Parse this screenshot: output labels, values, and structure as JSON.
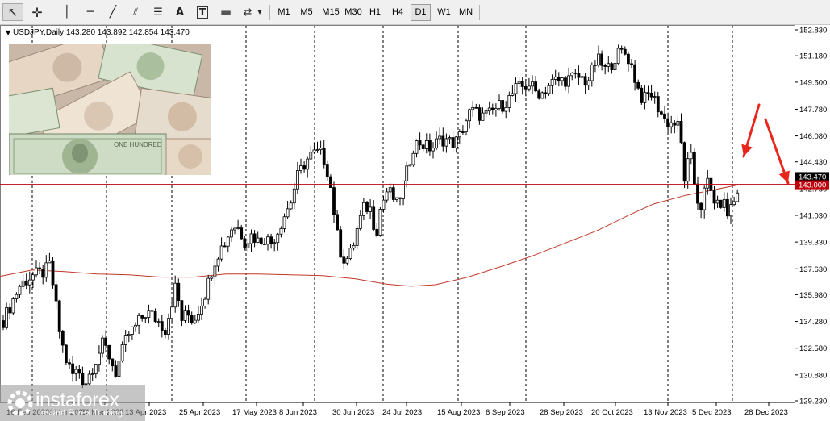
{
  "toolbar": {
    "tools": [
      {
        "name": "cursor-tool-button",
        "icon": "cursor-arrow-icon",
        "glyph": "↖",
        "selected": true
      },
      {
        "name": "crosshair-tool-button",
        "icon": "crosshair-icon",
        "glyph": "✛",
        "selected": false
      },
      {
        "name": "vertical-line-button",
        "icon": "vertical-line-icon",
        "glyph": "│",
        "selected": false
      },
      {
        "name": "horizontal-line-button",
        "icon": "horizontal-line-icon",
        "glyph": "─",
        "selected": false
      },
      {
        "name": "trendline-button",
        "icon": "trendline-icon",
        "glyph": "╱",
        "selected": false
      },
      {
        "name": "equidistant-channel-button",
        "icon": "channel-icon",
        "glyph": "⫽",
        "selected": false
      },
      {
        "name": "fibonacci-button",
        "icon": "fibonacci-icon",
        "glyph": "☰",
        "selected": false
      },
      {
        "name": "text-button",
        "icon": "text-icon",
        "glyph": "A",
        "selected": false
      },
      {
        "name": "text-label-button",
        "icon": "text-label-icon",
        "glyph": "T",
        "selected": false
      },
      {
        "name": "rectangle-shape-button",
        "icon": "rectangle-icon",
        "glyph": "▬",
        "selected": false
      },
      {
        "name": "arrows-shapes-button",
        "icon": "arrows-icon",
        "glyph": "⇄",
        "selected": false
      },
      {
        "name": "shapes-dropdown-button",
        "icon": "chevron-down-icon",
        "glyph": "▾",
        "selected": false
      }
    ],
    "timeframes": [
      "M1",
      "M5",
      "M15",
      "M30",
      "H1",
      "H4",
      "D1",
      "W1",
      "MN"
    ],
    "selected_timeframe": "D1"
  },
  "chart_title": "USDJPY,Daily  143.280 143.892 142.854 143.470",
  "chart_data": {
    "type": "candlestick",
    "symbol": "USDJPY",
    "timeframe": "Daily",
    "ohlc": {
      "open": 143.28,
      "high": 143.892,
      "low": 142.854,
      "close": 143.47
    },
    "y_ticks": [
      152.83,
      151.18,
      149.5,
      147.78,
      146.08,
      144.43,
      142.73,
      141.03,
      139.33,
      137.63,
      135.98,
      134.28,
      132.58,
      130.88,
      129.23
    ],
    "ylim": [
      129.23,
      152.83
    ],
    "x_labels": [
      "16 Feb 2023",
      "4 Mar 2023",
      "24 Mar 2023",
      "13 Apr 2023",
      "25 Apr 2023",
      "17 May 2023",
      "8 Jun 2023",
      "30 Jun 2023",
      "24 Jul 2023",
      "15 Aug 2023",
      "6 Sep 2023",
      "28 Sep 2023",
      "20 Oct 2023",
      "13 Nov 2023",
      "5 Dec 2023",
      "28 Dec 2023"
    ],
    "current_price": 143.47,
    "current_price_label": "143.470",
    "horizontal_level": 143.0,
    "horizontal_level_label": "143.000",
    "price_path": [
      [
        0,
        133.9
      ],
      [
        12,
        135.2
      ],
      [
        25,
        136.6
      ],
      [
        40,
        137.2
      ],
      [
        55,
        137.4
      ],
      [
        62,
        137.9
      ],
      [
        68,
        135.8
      ],
      [
        75,
        133.2
      ],
      [
        82,
        131.8
      ],
      [
        90,
        130.9
      ],
      [
        97,
        131.2
      ],
      [
        105,
        130.3
      ],
      [
        113,
        131.2
      ],
      [
        120,
        132.0
      ],
      [
        128,
        132.9
      ],
      [
        136,
        132.0
      ],
      [
        143,
        131.0
      ],
      [
        150,
        132.1
      ],
      [
        158,
        133.4
      ],
      [
        166,
        133.8
      ],
      [
        174,
        134.4
      ],
      [
        182,
        134.9
      ],
      [
        190,
        134.6
      ],
      [
        198,
        134.2
      ],
      [
        205,
        133.8
      ],
      [
        212,
        135.3
      ],
      [
        218,
        136.6
      ],
      [
        225,
        134.4
      ],
      [
        232,
        134.8
      ],
      [
        240,
        134.3
      ],
      [
        248,
        135.3
      ],
      [
        256,
        136.3
      ],
      [
        264,
        137.9
      ],
      [
        272,
        138.8
      ],
      [
        280,
        139.4
      ],
      [
        288,
        140.4
      ],
      [
        296,
        140.2
      ],
      [
        304,
        139.3
      ],
      [
        312,
        139.8
      ],
      [
        320,
        139.4
      ],
      [
        328,
        139.6
      ],
      [
        336,
        139.3
      ],
      [
        344,
        140.0
      ],
      [
        352,
        141.0
      ],
      [
        360,
        141.8
      ],
      [
        368,
        143.4
      ],
      [
        376,
        144.2
      ],
      [
        384,
        144.8
      ],
      [
        392,
        145.0
      ],
      [
        400,
        144.9
      ],
      [
        408,
        143.5
      ],
      [
        414,
        141.3
      ],
      [
        420,
        139.0
      ],
      [
        428,
        138.1
      ],
      [
        436,
        138.7
      ],
      [
        444,
        140.4
      ],
      [
        452,
        141.6
      ],
      [
        460,
        141.4
      ],
      [
        466,
        139.8
      ],
      [
        472,
        141.6
      ],
      [
        480,
        142.6
      ],
      [
        486,
        142.3
      ],
      [
        492,
        141.7
      ],
      [
        498,
        142.6
      ],
      [
        504,
        143.7
      ],
      [
        512,
        145.4
      ],
      [
        520,
        145.7
      ],
      [
        528,
        145.4
      ],
      [
        536,
        145.3
      ],
      [
        544,
        145.8
      ],
      [
        552,
        145.9
      ],
      [
        560,
        145.6
      ],
      [
        568,
        145.8
      ],
      [
        576,
        146.9
      ],
      [
        584,
        147.7
      ],
      [
        592,
        147.5
      ],
      [
        600,
        147.3
      ],
      [
        608,
        147.5
      ],
      [
        616,
        147.9
      ],
      [
        624,
        148.1
      ],
      [
        632,
        148.5
      ],
      [
        640,
        149.1
      ],
      [
        648,
        149.2
      ],
      [
        656,
        149.4
      ],
      [
        664,
        148.9
      ],
      [
        672,
        148.8
      ],
      [
        680,
        149.3
      ],
      [
        688,
        149.6
      ],
      [
        696,
        149.6
      ],
      [
        704,
        149.7
      ],
      [
        712,
        149.8
      ],
      [
        720,
        149.8
      ],
      [
        728,
        149.5
      ],
      [
        734,
        150.2
      ],
      [
        740,
        151.0
      ],
      [
        746,
        150.6
      ],
      [
        752,
        150.2
      ],
      [
        758,
        150.7
      ],
      [
        764,
        151.2
      ],
      [
        770,
        151.4
      ],
      [
        776,
        151.3
      ],
      [
        782,
        150.7
      ],
      [
        788,
        149.6
      ],
      [
        794,
        148.6
      ],
      [
        800,
        148.4
      ],
      [
        806,
        148.9
      ],
      [
        812,
        148.3
      ],
      [
        818,
        147.7
      ],
      [
        824,
        147.1
      ],
      [
        830,
        146.9
      ],
      [
        836,
        146.9
      ],
      [
        842,
        146.6
      ],
      [
        846,
        144.9
      ],
      [
        850,
        142.6
      ],
      [
        854,
        145.1
      ],
      [
        858,
        144.4
      ],
      [
        862,
        142.6
      ],
      [
        866,
        141.8
      ],
      [
        870,
        141.6
      ],
      [
        874,
        142.7
      ],
      [
        878,
        143.2
      ],
      [
        882,
        142.4
      ],
      [
        886,
        142.0
      ],
      [
        890,
        141.5
      ],
      [
        894,
        141.9
      ],
      [
        898,
        141.7
      ],
      [
        902,
        141.1
      ],
      [
        906,
        141.6
      ],
      [
        910,
        141.9
      ],
      [
        914,
        142.6
      ],
      [
        918,
        143.47
      ]
    ],
    "moving_average": [
      [
        0,
        137.15
      ],
      [
        40,
        137.55
      ],
      [
        80,
        137.45
      ],
      [
        120,
        137.3
      ],
      [
        160,
        137.25
      ],
      [
        200,
        137.1
      ],
      [
        240,
        137.1
      ],
      [
        280,
        137.3
      ],
      [
        320,
        137.3
      ],
      [
        360,
        137.25
      ],
      [
        400,
        137.2
      ],
      [
        440,
        137.0
      ],
      [
        480,
        136.65
      ],
      [
        510,
        136.52
      ],
      [
        540,
        136.62
      ],
      [
        580,
        137.1
      ],
      [
        620,
        137.75
      ],
      [
        660,
        138.45
      ],
      [
        700,
        139.25
      ],
      [
        740,
        140.05
      ],
      [
        780,
        141.05
      ],
      [
        810,
        141.75
      ],
      [
        850,
        142.3
      ],
      [
        880,
        142.6
      ],
      [
        918,
        143.0
      ]
    ],
    "annotations": [
      "red-down-arrow",
      "red-down-arrow"
    ],
    "grid": "vertical dotted separators at date labels"
  },
  "watermark": {
    "logo_icon": "instaforex-gear-icon",
    "brand": "instaforex",
    "tagline": "Instant Forex Trading"
  },
  "thumbnail": {
    "description_icon": "banknotes-image-icon"
  },
  "colors": {
    "candle": "#000000",
    "moving_average": "#c0392b",
    "level_line": "#c0000b",
    "price_box": "#000000",
    "level_box": "#c0000b",
    "arrow": "#e8261c",
    "toolbar_bg": "#f0f0f0",
    "grid": "#000000"
  }
}
